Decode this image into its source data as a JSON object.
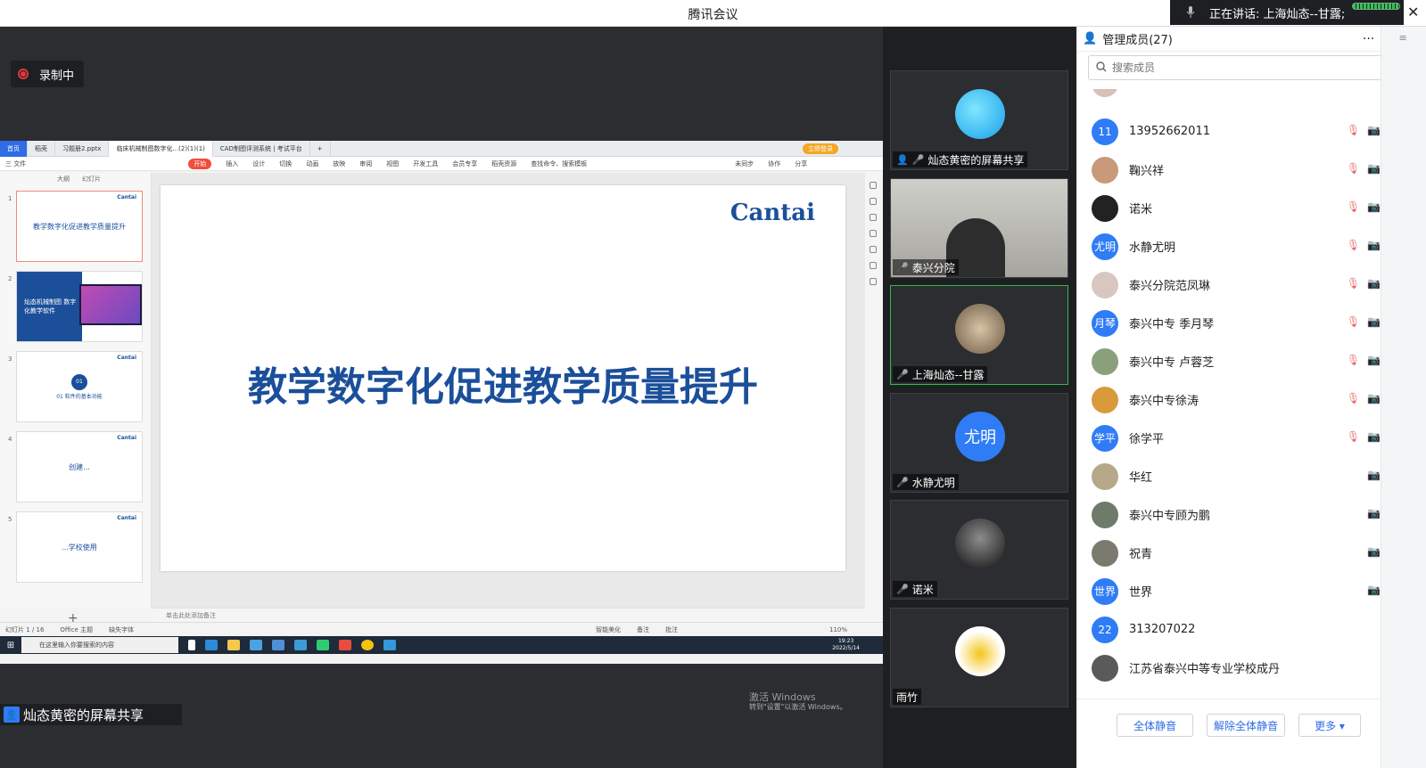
{
  "app_title": "腾讯会议",
  "speaking": "正在讲话: 上海灿态--甘露;",
  "recording_label": "录制中",
  "share_label": "灿态黄密的屏幕共享",
  "wps": {
    "tabs": [
      "首页",
      "稻壳",
      "习题册2.pptx",
      "临床机械制图数字化...(2)(1)(1)",
      "CAD制图评测系统 | 考试平台"
    ],
    "login": "立即登录",
    "menus": [
      "三 文件",
      "开始",
      "插入",
      "设计",
      "切换",
      "动画",
      "放映",
      "审阅",
      "视图",
      "开发工具",
      "会员专享",
      "稻壳资源",
      "查找命令、搜索模板",
      "未同步",
      "协作",
      "分享"
    ],
    "view_tabs": [
      "大纲",
      "幻灯片"
    ],
    "thumbs": [
      {
        "num": "1",
        "text": "教学数字化促进教学质量提升"
      },
      {
        "num": "2",
        "text": "灿态机械制图 数字化教学软件"
      },
      {
        "num": "3",
        "text": "01 软件的基本功能"
      },
      {
        "num": "4",
        "text": "创建..."
      },
      {
        "num": "5",
        "text": "...学校使用"
      }
    ],
    "thumb_brand": "Cantai",
    "slide_logo": "Cantai",
    "slide_title": "教学数字化促进教学质量提升",
    "notes": "单击此处添加备注",
    "status": [
      "幻灯片 1 / 16",
      "Office 主题",
      "缺失字体",
      "智能美化",
      "备注",
      "批注"
    ],
    "zoom": "110%",
    "activate_line1": "激活 Windows",
    "activate_line2": "转到\"设置\"以激活 Windows。",
    "taskbar_search": "在这里输入你要搜索的内容",
    "clock_time": "19:23",
    "clock_date": "2022/5/14"
  },
  "video_tiles": [
    {
      "label": "灿态黄密的屏幕共享"
    },
    {
      "label": "泰兴分院"
    },
    {
      "label": "上海灿态--甘露"
    },
    {
      "label": "水静尤明",
      "avatar_text": "尤明"
    },
    {
      "label": "诺米"
    },
    {
      "label": "雨竹"
    }
  ],
  "panel": {
    "title": "管理成员(27)",
    "search_placeholder": "搜索成员",
    "members": [
      {
        "name": "13952662011",
        "avatar": "11",
        "color": "#2f7cf6"
      },
      {
        "name": "鞠兴祥",
        "avatar": "",
        "color": "#c89a7a"
      },
      {
        "name": "诺米",
        "avatar": "",
        "color": "#222222"
      },
      {
        "name": "水静尤明",
        "avatar": "尤明",
        "color": "#2f7cf6"
      },
      {
        "name": "泰兴分院范凤琳",
        "avatar": "",
        "color": "#d8c7c0"
      },
      {
        "name": "泰兴中专 季月琴",
        "avatar": "月琴",
        "color": "#2f7cf6"
      },
      {
        "name": "泰兴中专 卢蓉芝",
        "avatar": "",
        "color": "#8aa07a"
      },
      {
        "name": "泰兴中专徐涛",
        "avatar": "",
        "color": "#d89a3a"
      },
      {
        "name": "徐学平",
        "avatar": "学平",
        "color": "#2f7cf6"
      },
      {
        "name": "华红",
        "avatar": "",
        "color": "#b8a88a"
      },
      {
        "name": "泰兴中专顾为鹏",
        "avatar": "",
        "color": "#6e7a6a"
      },
      {
        "name": "祝青",
        "avatar": "",
        "color": "#7a7a6e"
      },
      {
        "name": "世界",
        "avatar": "世界",
        "color": "#2f7cf6"
      },
      {
        "name": "313207022",
        "avatar": "22",
        "color": "#2f7cf6"
      },
      {
        "name": "江苏省泰兴中等专业学校成丹",
        "avatar": "",
        "color": "#5a5a5a"
      }
    ],
    "buttons": {
      "mute_all": "全体静音",
      "unmute_all": "解除全体静音",
      "more": "更多 ▾"
    }
  }
}
